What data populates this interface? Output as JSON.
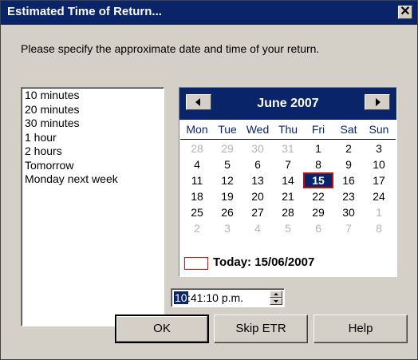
{
  "window": {
    "title": "Estimated Time of Return...",
    "close_glyph": "✕"
  },
  "prompt": "Please specify the approximate date and time of your return.",
  "presets": [
    "10 minutes",
    "20 minutes",
    "30 minutes",
    "1 hour",
    "2 hours",
    "Tomorrow",
    "Monday next week"
  ],
  "calendar": {
    "month_label": "June 2007",
    "weekdays": [
      "Mon",
      "Tue",
      "Wed",
      "Thu",
      "Fri",
      "Sat",
      "Sun"
    ],
    "weeks": [
      [
        {
          "d": "28",
          "o": true
        },
        {
          "d": "29",
          "o": true
        },
        {
          "d": "30",
          "o": true
        },
        {
          "d": "31",
          "o": true
        },
        {
          "d": "1"
        },
        {
          "d": "2"
        },
        {
          "d": "3"
        }
      ],
      [
        {
          "d": "4"
        },
        {
          "d": "5"
        },
        {
          "d": "6"
        },
        {
          "d": "7"
        },
        {
          "d": "8"
        },
        {
          "d": "9"
        },
        {
          "d": "10"
        }
      ],
      [
        {
          "d": "11"
        },
        {
          "d": "12"
        },
        {
          "d": "13"
        },
        {
          "d": "14"
        },
        {
          "d": "15",
          "sel": true
        },
        {
          "d": "16"
        },
        {
          "d": "17"
        }
      ],
      [
        {
          "d": "18"
        },
        {
          "d": "19"
        },
        {
          "d": "20"
        },
        {
          "d": "21"
        },
        {
          "d": "22"
        },
        {
          "d": "23"
        },
        {
          "d": "24"
        }
      ],
      [
        {
          "d": "25"
        },
        {
          "d": "26"
        },
        {
          "d": "27"
        },
        {
          "d": "28"
        },
        {
          "d": "29"
        },
        {
          "d": "30"
        },
        {
          "d": "1",
          "o": true
        }
      ],
      [
        {
          "d": "2",
          "o": true
        },
        {
          "d": "3",
          "o": true
        },
        {
          "d": "4",
          "o": true
        },
        {
          "d": "5",
          "o": true
        },
        {
          "d": "6",
          "o": true
        },
        {
          "d": "7",
          "o": true
        },
        {
          "d": "8",
          "o": true
        }
      ]
    ],
    "today_label": "Today: 15/06/2007"
  },
  "time": {
    "hour_selected": "10",
    "rest": ":41:10 p.m."
  },
  "buttons": {
    "ok": "OK",
    "skip": "Skip ETR",
    "help": "Help"
  },
  "colors": {
    "titlebar": "#0a246a",
    "dialog_bg": "#d4d0c8",
    "today_marker": "#ff0000"
  }
}
